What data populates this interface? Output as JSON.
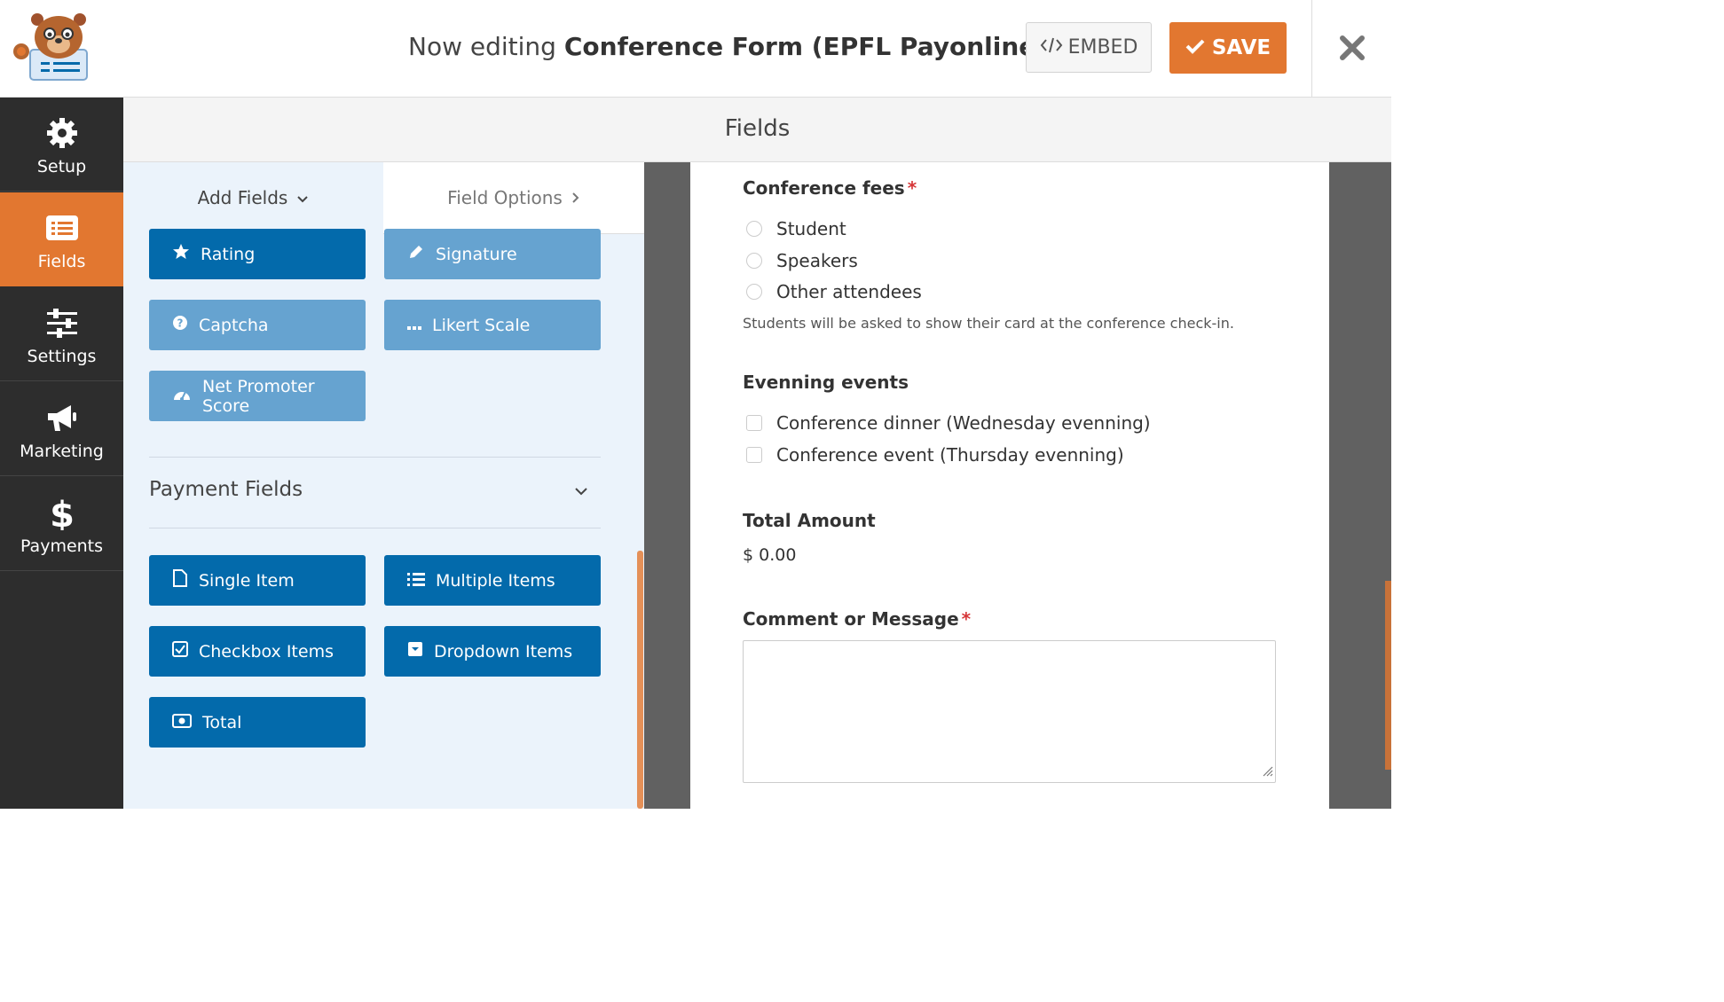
{
  "header": {
    "title_prefix": "Now editing ",
    "form_name": "Conference Form (EPFL Payonline)",
    "embed_label": "EMBED",
    "save_label": "SAVE",
    "accent_color": "#e27730"
  },
  "sidebar": {
    "items": [
      {
        "label": "Setup",
        "icon": "gear-icon"
      },
      {
        "label": "Fields",
        "icon": "form-list-icon",
        "active": true
      },
      {
        "label": "Settings",
        "icon": "sliders-icon"
      },
      {
        "label": "Marketing",
        "icon": "megaphone-icon"
      },
      {
        "label": "Payments",
        "icon": "dollar-icon"
      }
    ]
  },
  "fields_header": "Fields",
  "tabs": {
    "add_fields": "Add Fields",
    "field_options": "Field Options"
  },
  "fancy_fields": [
    {
      "label": "Rating",
      "icon": "star-icon"
    },
    {
      "label": "Signature",
      "icon": "pencil-icon"
    },
    {
      "label": "Captcha",
      "icon": "question-circle-icon"
    },
    {
      "label": "Likert Scale",
      "icon": "ellipsis-icon"
    },
    {
      "label": "Net Promoter Score",
      "icon": "gauge-icon"
    }
  ],
  "payment_section": {
    "title": "Payment Fields",
    "buttons": [
      {
        "label": "Single Item",
        "icon": "file-icon"
      },
      {
        "label": "Multiple Items",
        "icon": "list-icon"
      },
      {
        "label": "Checkbox Items",
        "icon": "checkbox-icon"
      },
      {
        "label": "Dropdown Items",
        "icon": "dropdown-icon"
      },
      {
        "label": "Total",
        "icon": "money-icon"
      }
    ]
  },
  "preview": {
    "conference_fees": {
      "label": "Conference fees",
      "required_mark": "*",
      "options": [
        "Student",
        "Speakers",
        "Other attendees"
      ],
      "description": "Students will be asked to show their card at the conference check-in."
    },
    "evening_events": {
      "label": "Evenning events",
      "options": [
        "Conference dinner (Wednesday evenning)",
        "Conference event (Thursday evenning)"
      ]
    },
    "total_amount": {
      "label": "Total Amount",
      "value": "$ 0.00"
    },
    "comment": {
      "label": "Comment or Message",
      "required_mark": "*",
      "value": ""
    }
  }
}
